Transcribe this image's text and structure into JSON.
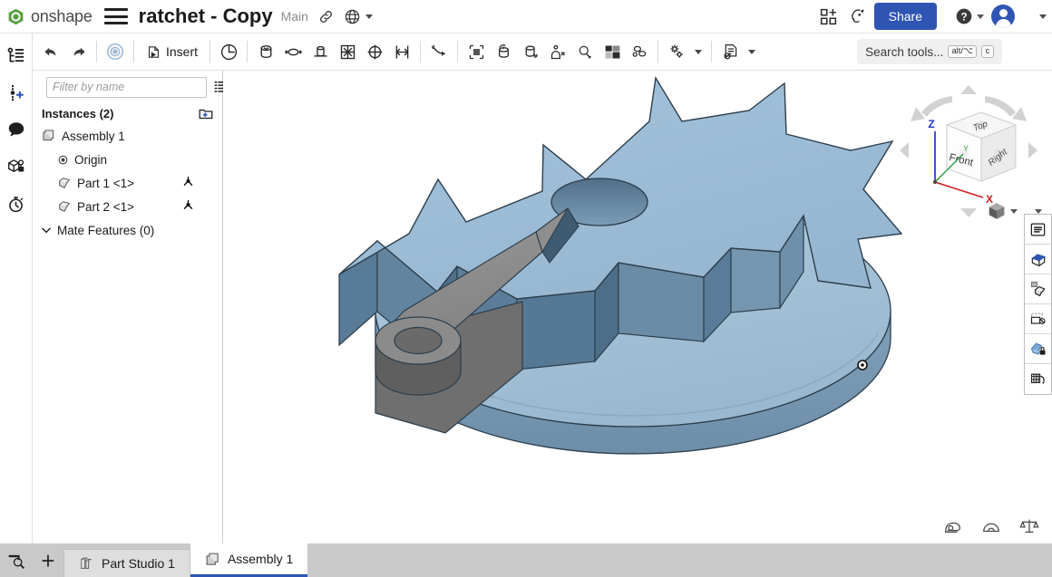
{
  "app": {
    "brand": "onshape",
    "brand_color": "#5a9e44",
    "accent_color": "#2f55b3"
  },
  "header": {
    "menu_icon": "hamburger-menu-icon",
    "document_title": "ratchet - Copy",
    "workspace": "Main",
    "link_icon": "link-icon",
    "globe_icon": "globe-public-icon",
    "apps_icon": "apps-grid-add-icon",
    "ai_icon": "ai-assistant-icon",
    "share_label": "Share",
    "help_icon": "help-question-icon",
    "avatar_icon": "user-avatar",
    "overflow_icon": "chevron-down-icon"
  },
  "toolbar": {
    "undo_label": "Undo",
    "redo_label": "Redo",
    "insert_label": "Insert",
    "items": [
      {
        "name": "undo-button",
        "icon": "undo-arrow-icon"
      },
      {
        "name": "redo-button",
        "icon": "redo-arrow-icon"
      },
      {
        "name": "assemble-button",
        "icon": "target-circle-icon"
      },
      {
        "name": "insert-button",
        "icon": "insert-part-icon"
      },
      {
        "name": "mate-revolute-button",
        "icon": "revolute-mate-icon"
      },
      {
        "name": "mate-cylindrical-button",
        "icon": "cylindrical-mate-icon"
      },
      {
        "name": "mate-ball-button",
        "icon": "ball-mate-icon"
      },
      {
        "name": "mate-slider-button",
        "icon": "slider-mate-icon"
      },
      {
        "name": "mate-planar-button",
        "icon": "planar-mate-icon"
      },
      {
        "name": "mate-pin-slot-button",
        "icon": "pin-slot-mate-icon"
      },
      {
        "name": "mate-parallel-button",
        "icon": "parallel-mate-icon"
      },
      {
        "name": "mate-fastened-button",
        "icon": "fastened-mate-icon"
      },
      {
        "name": "mate-connector-button",
        "icon": "mate-connector-icon"
      },
      {
        "name": "group-button",
        "icon": "group-icon"
      },
      {
        "name": "replicate-button",
        "icon": "replicate-icon"
      },
      {
        "name": "pattern-button",
        "icon": "pattern-icon"
      },
      {
        "name": "mirror-button",
        "icon": "mirror-icon"
      },
      {
        "name": "explode-button",
        "icon": "explode-icon"
      },
      {
        "name": "display-state-button",
        "icon": "display-state-icon"
      },
      {
        "name": "bom-button",
        "icon": "bill-of-materials-icon"
      }
    ],
    "search_placeholder": "Search tools...",
    "kbd_alt": "alt/⌥",
    "kbd_key": "c"
  },
  "rail": {
    "items": [
      {
        "name": "sidebar-item-feature-list",
        "icon": "structure-tree-icon"
      },
      {
        "name": "sidebar-item-add-instance",
        "icon": "add-point-icon"
      },
      {
        "name": "sidebar-item-comments",
        "icon": "comment-bubble-icon"
      },
      {
        "name": "sidebar-item-part-properties",
        "icon": "part-pin-icon"
      },
      {
        "name": "sidebar-item-history",
        "icon": "stopwatch-icon"
      }
    ]
  },
  "sidebar": {
    "filter_placeholder": "Filter by name",
    "filter_value": "",
    "filter_icon": "funnel-filter-icon",
    "list_view_icon": "list-view-icon",
    "instances_label": "Instances (2)",
    "add_folder_icon": "add-folder-icon",
    "tree": [
      {
        "label": "Assembly 1",
        "icon": "assembly-icon",
        "indent": 0,
        "mate_icon": ""
      },
      {
        "label": "Origin",
        "icon": "origin-icon",
        "indent": 1,
        "mate_icon": ""
      },
      {
        "label": "Part 1 <1>",
        "icon": "part-icon",
        "indent": 1,
        "mate_icon": "mate-connector-icon"
      },
      {
        "label": "Part 2 <1>",
        "icon": "part-icon",
        "indent": 1,
        "mate_icon": "mate-connector-icon"
      }
    ],
    "mate_features_label": "Mate Features (0)",
    "mate_features_chevron": "chevron-down-icon",
    "flyout_icon": "panel-list-icon"
  },
  "viewcube": {
    "face_top": "Top",
    "face_front": "Front",
    "face_right": "Right",
    "axis_x": "X",
    "axis_y": "Y",
    "axis_z": "Z",
    "axis_x_color": "#cc2222",
    "axis_y_color": "#2f9e3e",
    "axis_z_color": "#2233cc"
  },
  "view_panel": {
    "shade_cube_icon": "shaded-view-cube-icon",
    "shade_cube_chevron": "chevron-down-icon",
    "collapse_icon": "chevron-down-small-icon",
    "buttons": [
      {
        "name": "view-list-button",
        "icon": "view-list-icon"
      },
      {
        "name": "section-view-button",
        "icon": "section-view-icon"
      },
      {
        "name": "hide-show-button",
        "icon": "hide-show-parts-icon"
      },
      {
        "name": "transparency-button",
        "icon": "transparency-icon"
      },
      {
        "name": "appearance-lock-button",
        "icon": "appearance-lock-icon"
      },
      {
        "name": "exploded-view-button",
        "icon": "exploded-view-icon"
      }
    ]
  },
  "measure_tools": [
    {
      "name": "measure-tape-button",
      "icon": "measure-tape-icon"
    },
    {
      "name": "measure-angle-button",
      "icon": "protractor-icon"
    },
    {
      "name": "mass-properties-button",
      "icon": "scale-balance-icon"
    }
  ],
  "tabbar": {
    "search_icon": "tab-search-icon",
    "add_label": "+",
    "tabs": [
      {
        "label": "Part Studio 1",
        "icon": "part-studio-icon",
        "active": false
      },
      {
        "label": "Assembly 1",
        "icon": "assembly-icon",
        "active": true
      }
    ]
  },
  "model": {
    "description": "Ratchet assembly: blue-gray ratchet gear on circular base disc with gray pawl lever arm",
    "gear_top_color": "#9dbcd6",
    "gear_side_color": "#5d7f9b",
    "gear_dark_color": "#4f6f8a",
    "base_top_color": "#a6c2d8",
    "base_side_color": "#6b8da8",
    "arm_top_color": "#8b8b8b",
    "arm_side_color": "#6f6f6f",
    "arm_dark_color": "#5c5c5c",
    "edge_color": "#2c3e4c",
    "teeth_count": 10,
    "origin_marker": "origin-dot-marker"
  }
}
